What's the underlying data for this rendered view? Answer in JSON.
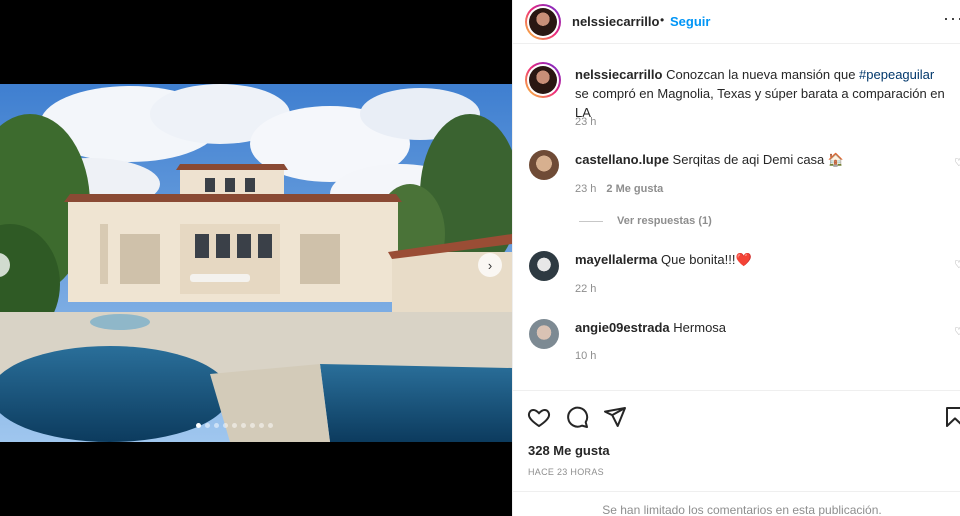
{
  "post": {
    "author": "nelssiecarrillo",
    "separator": "•",
    "follow_label": "Seguir",
    "more_label": "···",
    "caption_prefix": "Conozcan la nueva mansión que ",
    "caption_hashtag": "#pepeaguilar",
    "caption_suffix": " se compró en Magnolia, Texas y súper barata a comparación en LA",
    "caption_time": "23 h",
    "likes": "328 Me gusta",
    "posted_ago": "HACE 23 HORAS",
    "comments_limited": "Se han limitado los comentarios en esta publicación."
  },
  "comments": [
    {
      "user": "castellano.lupe",
      "text": "Serqitas de aqi Demi casa 🏠",
      "time": "23 h",
      "likes": "2 Me gusta"
    },
    {
      "user": "mayellalerma",
      "text": "Que bonita!!!❤️",
      "time": "22 h",
      "likes": ""
    },
    {
      "user": "angie09estrada",
      "text": "Hermosa",
      "time": "10 h",
      "likes": ""
    }
  ],
  "view_replies": "Ver respuestas (1)",
  "icons": {
    "like": "heart-icon",
    "comment": "comment-icon",
    "share": "send-icon",
    "save": "bookmark-icon",
    "prev": "chevron-left-icon",
    "next": "chevron-right-icon",
    "comment_like": "small-heart-icon"
  },
  "colors": {
    "link": "#0095f6",
    "hashtag": "#00376b",
    "muted": "#8e8e8e"
  },
  "carousel": {
    "count": 9,
    "active": 0
  }
}
